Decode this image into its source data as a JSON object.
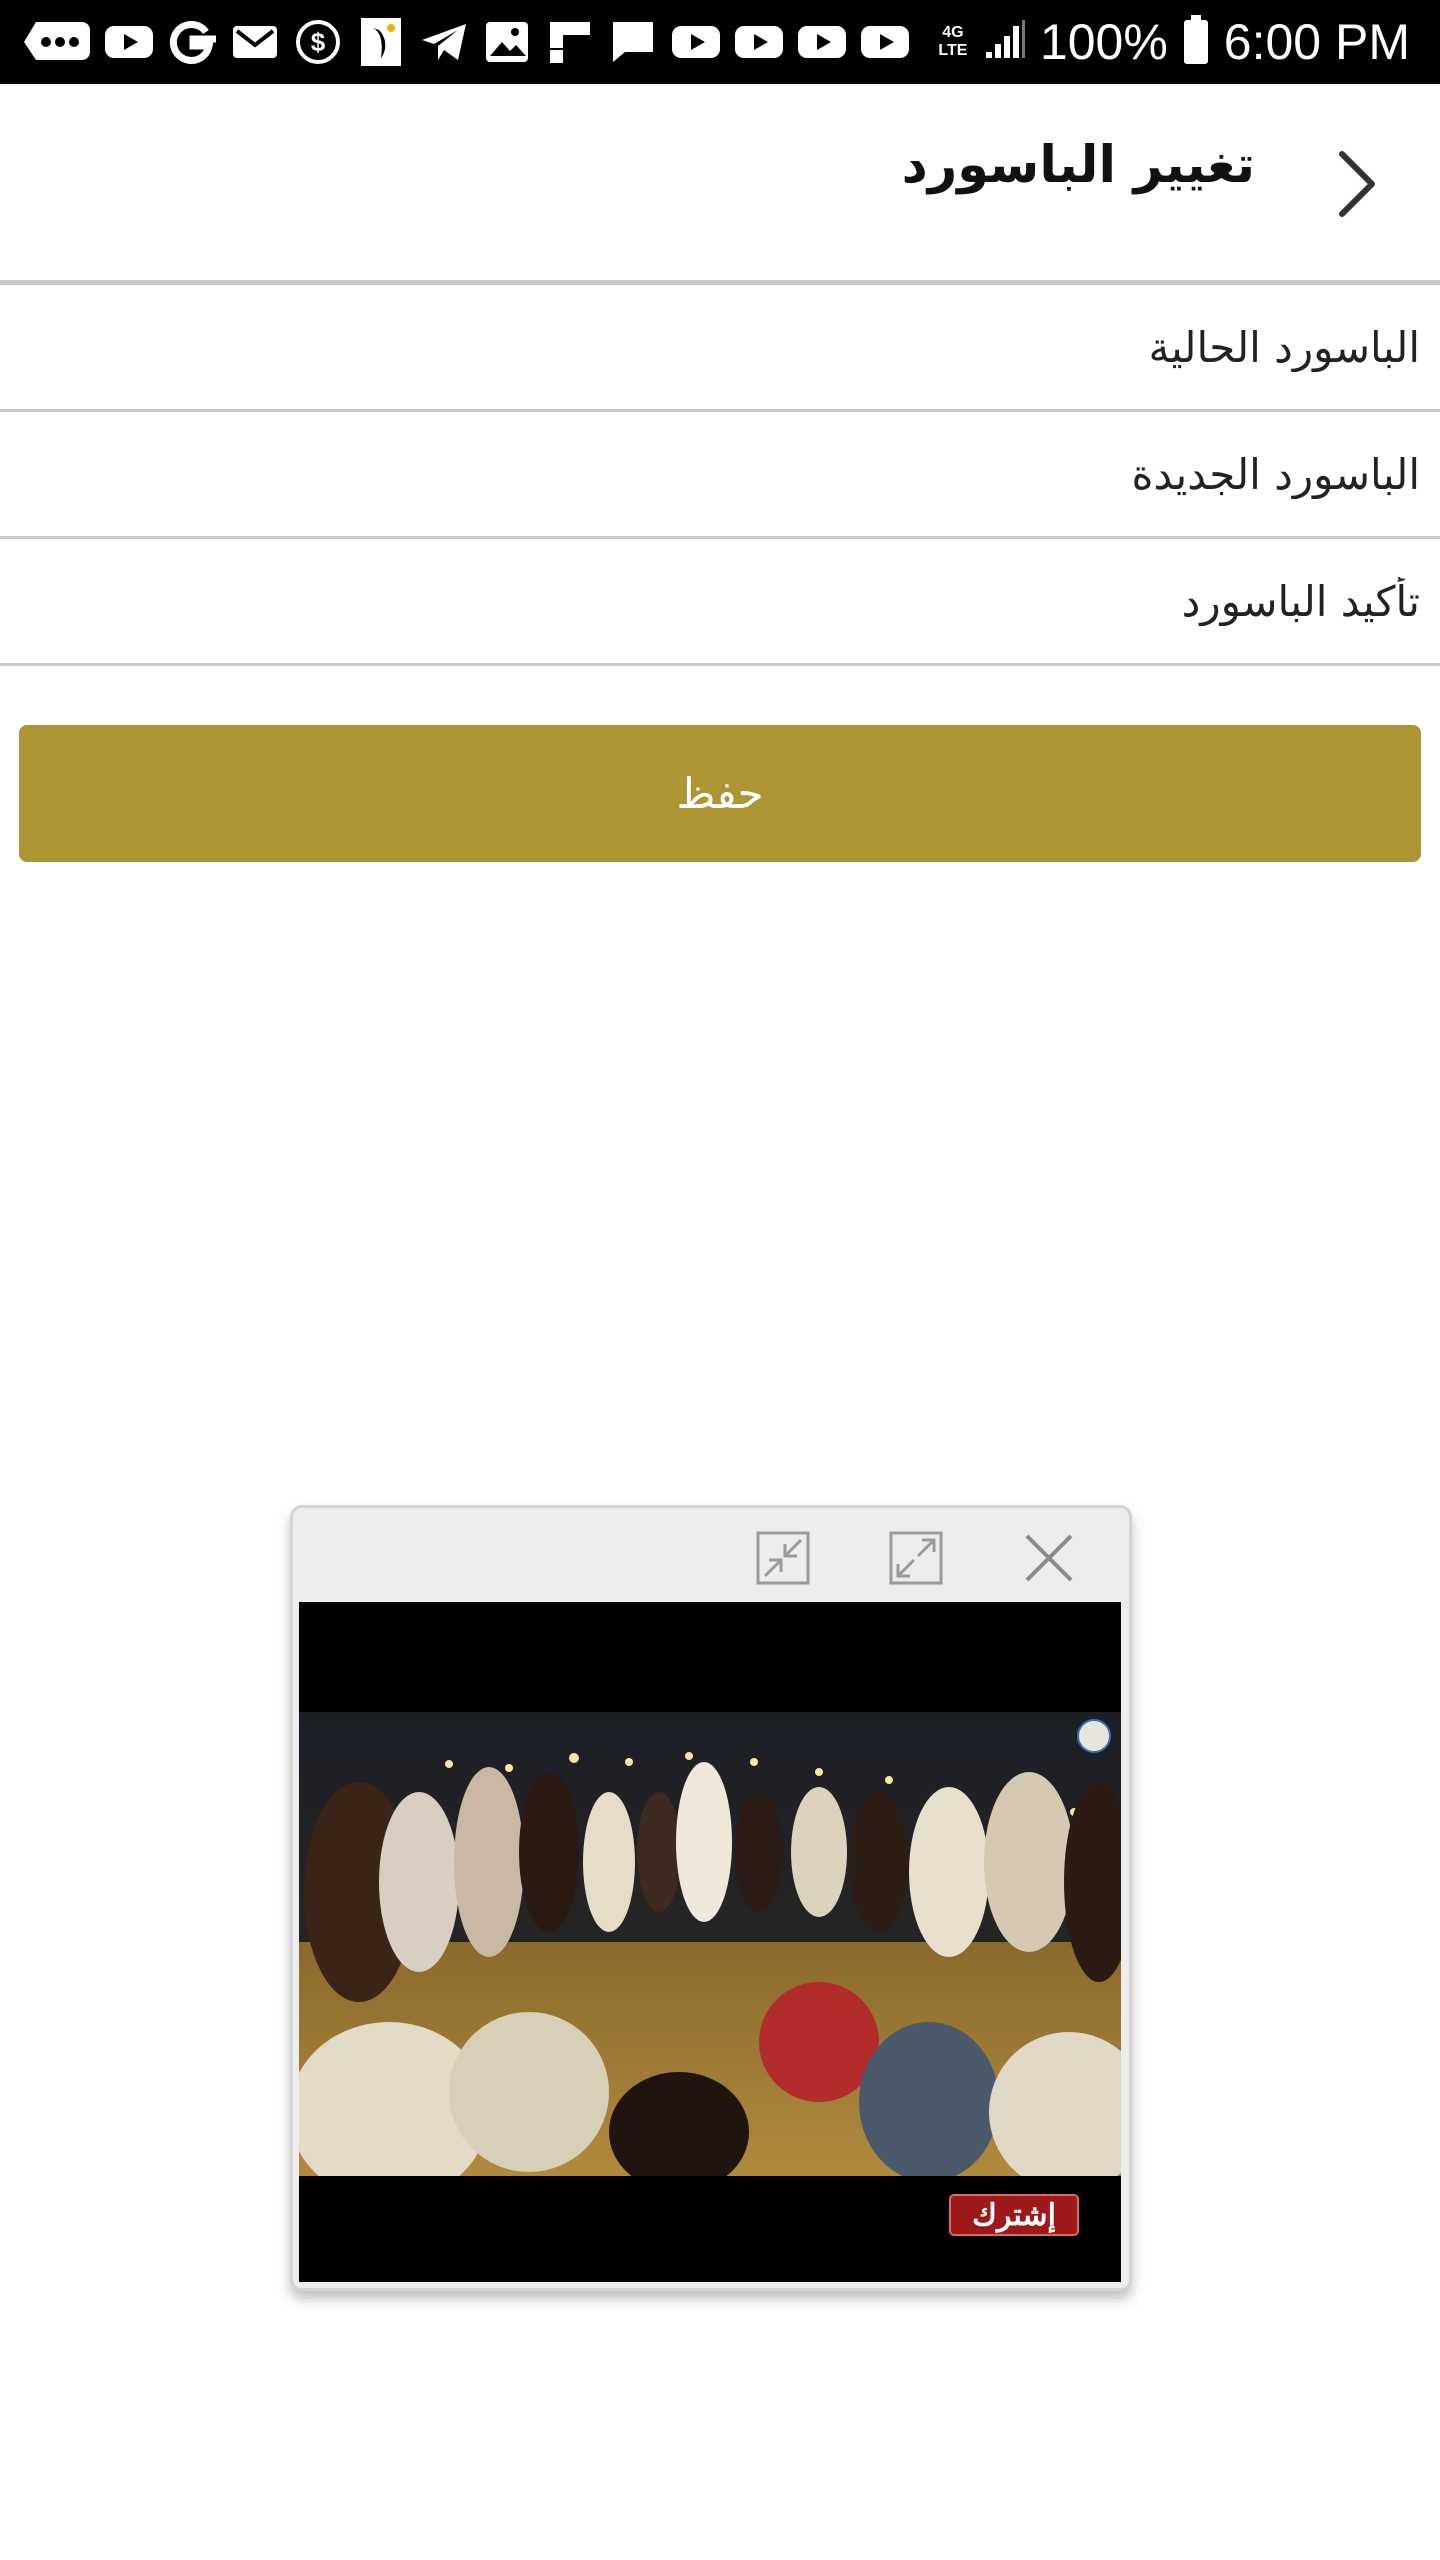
{
  "status_bar": {
    "network": "4G LTE",
    "battery": "100%",
    "time": "6:00 PM",
    "icons": [
      "chat-bubble-icon",
      "youtube-icon",
      "google-icon",
      "gmail-icon",
      "money-icon",
      "bird-app-icon",
      "telegram-icon",
      "gallery-icon",
      "flipboard-icon",
      "message-icon",
      "youtube-icon",
      "youtube-icon",
      "youtube-icon",
      "youtube-icon"
    ]
  },
  "header": {
    "title": "تغيير الباسورد",
    "back_icon": "chevron-right-icon"
  },
  "form": {
    "current_password_placeholder": "الباسورد الحالية",
    "new_password_placeholder": "الباسورد الجديدة",
    "confirm_password_placeholder": "تأكيد الباسورد",
    "save_label": "حفظ"
  },
  "mini_player": {
    "minimize_icon": "collapse-icon",
    "expand_icon": "expand-icon",
    "close_icon": "close-icon",
    "subscribe_label": "إشترك"
  },
  "colors": {
    "accent": "#ad9534",
    "divider": "#c8c8c8",
    "status_bar": "#000000"
  }
}
